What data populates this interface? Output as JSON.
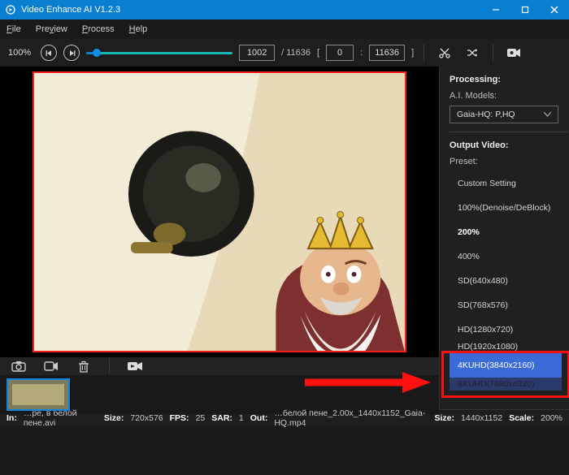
{
  "titlebar": {
    "app_title": "Video Enhance AI V1.2.3"
  },
  "menu": {
    "file": "File",
    "preview": "Preview",
    "process": "Process",
    "help": "Help"
  },
  "toolbar": {
    "zoom": "100%",
    "frame_current": "1002",
    "frame_total": "/ 11636",
    "range_start": "0",
    "range_sep": ":",
    "range_end": "11636"
  },
  "side": {
    "processing_title": "Processing:",
    "model_label": "A.I. Models:",
    "model_value": "Gaia-HQ: P,HQ",
    "output_title": "Output Video:",
    "preset_label": "Preset:",
    "presets": [
      "Custom Setting",
      "100%(Denoise/DeBlock)",
      "200%",
      "400%",
      "SD(640x480)",
      "SD(768x576)",
      "HD(1280x720)",
      "HD(1920x1080)",
      "4KUHD(3840x2160)",
      "8KUHD(7680x4320)"
    ]
  },
  "status": {
    "in_label": "In:",
    "in_value": "…pe, в белой пене.avi",
    "size1_label": "Size:",
    "size1_value": "720x576",
    "fps_label": "FPS:",
    "fps_value": "25",
    "sar_label": "SAR:",
    "sar_value": "1",
    "out_label": "Out:",
    "out_value": "…белой пене_2.00x_1440x1152_Gaia-HQ.mp4",
    "size2_label": "Size:",
    "size2_value": "1440x1152",
    "scale_label": "Scale:",
    "scale_value": "200%"
  }
}
